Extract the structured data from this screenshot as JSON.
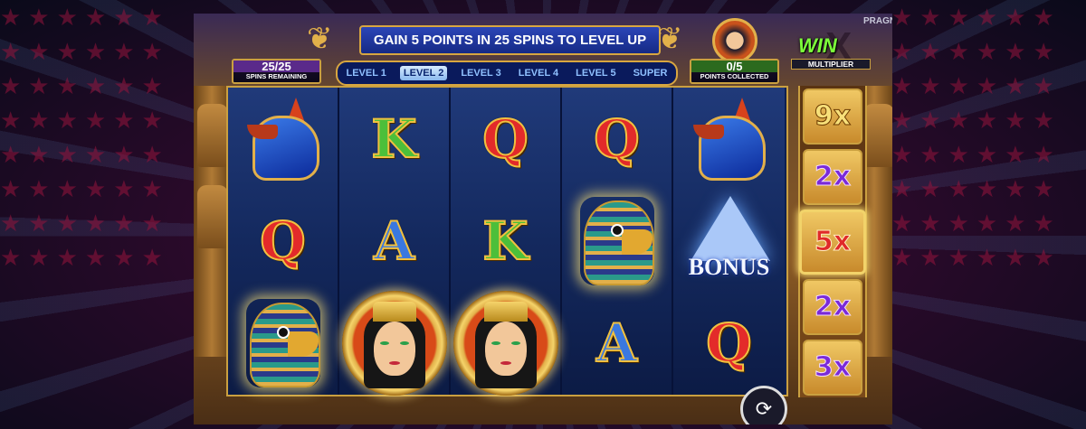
{
  "header": {
    "objective": "GAIN 5 POINTS IN 25 SPINS TO LEVEL UP",
    "provider_mark": "PRAGN"
  },
  "spins": {
    "value": "25/25",
    "label": "SPINS REMAINING"
  },
  "points": {
    "value": "0/5",
    "label": "POINTS COLLECTED"
  },
  "levels": [
    {
      "label": "LEVEL 1",
      "active": false
    },
    {
      "label": "LEVEL 2",
      "active": true
    },
    {
      "label": "LEVEL 3",
      "active": false
    },
    {
      "label": "LEVEL 4",
      "active": false
    },
    {
      "label": "LEVEL 5",
      "active": false
    },
    {
      "label": "SUPER",
      "active": false
    }
  ],
  "win_multiplier": {
    "logo_top": "WIN",
    "logo_bottom": "MULTIPLIER"
  },
  "reels": [
    [
      "anubis",
      "Q",
      "horus"
    ],
    [
      "K",
      "A",
      "cleopatra"
    ],
    [
      "Q",
      "K",
      "cleopatra"
    ],
    [
      "Q",
      "horus",
      "A"
    ],
    [
      "anubis",
      "bonus",
      "Q"
    ]
  ],
  "bonus_symbol": {
    "label": "BONUS"
  },
  "multipliers": [
    {
      "label": "9x",
      "color": "gold"
    },
    {
      "label": "2x",
      "color": "purple"
    },
    {
      "label": "5x",
      "color": "red",
      "selected": true
    },
    {
      "label": "2x",
      "color": "purple"
    },
    {
      "label": "3x",
      "color": "purple"
    }
  ],
  "colors": {
    "letter_K": "#4cbf3a",
    "letter_Q": "#e32a2a",
    "letter_A": "#3a78e0",
    "accent_gold": "#e2b04a"
  }
}
